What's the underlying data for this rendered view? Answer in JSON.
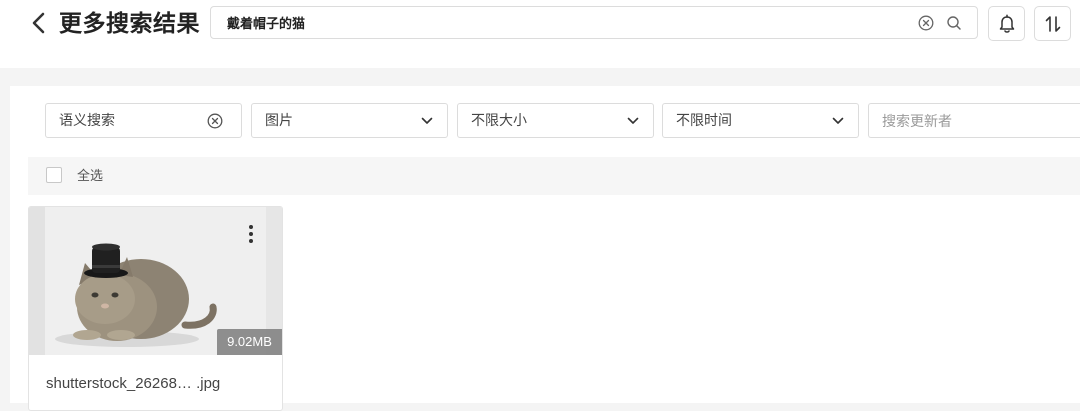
{
  "header": {
    "title": "更多搜索结果",
    "search_value": "戴着帽子的猫"
  },
  "filters": {
    "semantic_label": "语义搜索",
    "type_value": "图片",
    "size_value": "不限大小",
    "time_value": "不限时间",
    "updater_placeholder": "搜索更新者"
  },
  "selection": {
    "select_all_label": "全选"
  },
  "results": [
    {
      "file_name": "shutterstock_26268… .jpg",
      "file_size": "9.02MB",
      "thumbnail": "cat-with-black-top-hat"
    }
  ],
  "icons": {
    "back": "chevron-left-icon",
    "clear": "circle-x-icon",
    "search": "magnifier-icon",
    "bell": "bell-icon",
    "sort": "sort-arrows-icon",
    "dropdown": "chevron-down-icon",
    "more": "vertical-dots-icon"
  },
  "colors": {
    "page_background": "#f4f4f4",
    "panel_background": "#ffffff",
    "border": "#dcdcdc",
    "size_badge": "#7d7d7d"
  }
}
